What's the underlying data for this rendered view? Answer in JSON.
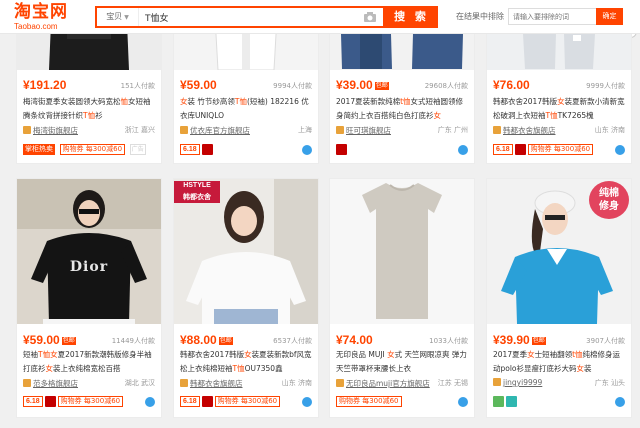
{
  "header": {
    "logo_cn": "淘宝网",
    "logo_en": "Taobao.com",
    "scope_label": "宝贝",
    "search_query": "T恤女",
    "search_button": "搜 索",
    "within_label": "在结果中排除",
    "keyword_placeholder": "请输入要排除的词",
    "confirm_button": "确定"
  },
  "colors": {
    "accent": "#ff4400",
    "tmall": "#c40000"
  },
  "products": [
    {
      "price": "¥191.20",
      "pay": "151人付款",
      "tag": "",
      "title_parts": [
        "梅湾街夏季女装圆领大码宽松",
        "恤",
        "女短袖腾条纹背拼接针织",
        "T恤",
        "衫"
      ],
      "shop": "梅湾街旗舰店",
      "location": "浙江 嘉兴",
      "badges": {
        "b1": "掌柜热卖",
        "b2": "购物券 每300减60",
        "b3": "广告"
      }
    },
    {
      "price": "¥59.00",
      "pay": "9994人付款",
      "tag": "",
      "title_parts": [
        "女",
        "装 竹节纱高领",
        "T恤",
        "(短袖) 182216 优衣库UNIQLO"
      ],
      "shop": "优衣库官方旗舰店",
      "location": "上海",
      "badges": {
        "b1": "6.18",
        "b2": "",
        "b3": ""
      }
    },
    {
      "price": "¥39.00",
      "pay": "29608人付款",
      "tag": "包邮",
      "title_parts": [
        "2017夏装新款纯棉",
        "t恤",
        "女式短袖圆领修身简约上衣百搭纯白色打底衫",
        "女"
      ],
      "shop": "旺可琪旗舰店",
      "location": "广东 广州",
      "badges": {
        "b1": "",
        "b2": "",
        "b3": ""
      }
    },
    {
      "price": "¥76.00",
      "pay": "9999人付款",
      "tag": "",
      "title_parts": [
        "韩都衣舍2017韩版",
        "女",
        "装夏新款小清新宽松破洞上衣短袖",
        "T恤",
        "TK7265槐"
      ],
      "shop": "韩都衣舍旗舰店",
      "location": "山东 济南",
      "badges": {
        "b1": "6.18",
        "b2": "购物券 每300减60",
        "b3": ""
      }
    },
    {
      "price": "¥59.00",
      "pay": "11449人付款",
      "tag": "包邮",
      "title_parts": [
        "短袖",
        "T恤女",
        "夏2017新款潮韩版修身半袖打底衫",
        "女",
        "装上衣纯棉宽松百搭"
      ],
      "shop": "范多格旗舰店",
      "location": "湖北 武汉",
      "badges": {
        "b1": "6.18",
        "b2": "购物券 每300减60",
        "b3": ""
      }
    },
    {
      "price": "¥88.00",
      "pay": "6537人付款",
      "tag": "包邮",
      "title_parts": [
        "韩都衣舍2017韩版",
        "女",
        "装夏装新款bf风宽松上衣纯棉短袖",
        "T恤",
        "OU7350鑫"
      ],
      "shop": "韩都衣舍旗舰店",
      "location": "山东 济南",
      "badges": {
        "b1": "6.18",
        "b2": "购物券 每300减60",
        "b3": ""
      }
    },
    {
      "price": "¥74.00",
      "pay": "1033人付款",
      "tag": "",
      "title_parts": [
        "无印良品 MUJI ",
        "女",
        "式 天竺网眼凉爽 弹力天竺带罩杯束腰长上衣"
      ],
      "shop": "无印良品muji官方旗舰店",
      "location": "江苏 无锡",
      "badges": {
        "b1": "",
        "b2": "购物券 每300减60",
        "b3": ""
      }
    },
    {
      "price": "¥39.90",
      "pay": "3907人付款",
      "tag": "包邮",
      "title_parts": [
        "2017夏季",
        "女",
        "士短袖翻领",
        "t恤",
        "纯棉修身运动polo衫显瘦打底衫大码",
        "女",
        "装"
      ],
      "shop": "jingyi9999",
      "location": "广东 汕头",
      "badges": {
        "b1": "",
        "b2": "",
        "b3": ""
      }
    }
  ],
  "overlays": {
    "hstyle_en": "HSTYLE",
    "hstyle_cn": "韩都衣舍",
    "cotton_line1": "纯棉",
    "cotton_line2": "修身",
    "dior": "Dior"
  }
}
